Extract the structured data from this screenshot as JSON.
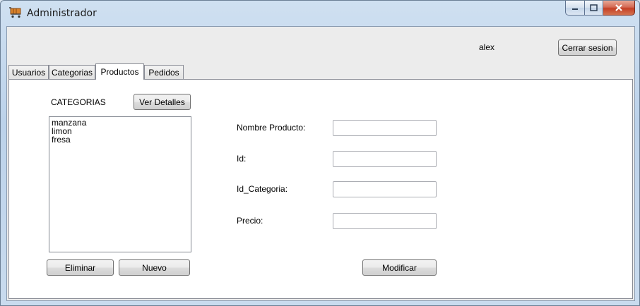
{
  "window": {
    "title": "Administrador"
  },
  "header": {
    "user": "alex",
    "logout_label": "Cerrar sesion"
  },
  "tabs": [
    {
      "label": "Usuarios"
    },
    {
      "label": "Categorias"
    },
    {
      "label": "Productos"
    },
    {
      "label": "Pedidos"
    }
  ],
  "active_tab": "Productos",
  "categories_panel": {
    "title": "CATEGORIAS",
    "details_label": "Ver Detalles",
    "items": [
      "manzana",
      "limon",
      "fresa"
    ],
    "delete_label": "Eliminar",
    "new_label": "Nuevo"
  },
  "product_form": {
    "name_label": "Nombre Producto:",
    "name_value": "",
    "id_label": "Id:",
    "id_value": "",
    "category_id_label": "Id_Categoria:",
    "category_id_value": "",
    "price_label": "Precio:",
    "price_value": "",
    "modify_label": "Modificar"
  },
  "icons": {
    "app": "shopping-cart-icon",
    "minimize": "minimize-icon",
    "maximize": "maximize-icon",
    "close": "close-icon"
  },
  "colors": {
    "close_button": "#c43f25",
    "title_bar": "#c9dbee"
  }
}
